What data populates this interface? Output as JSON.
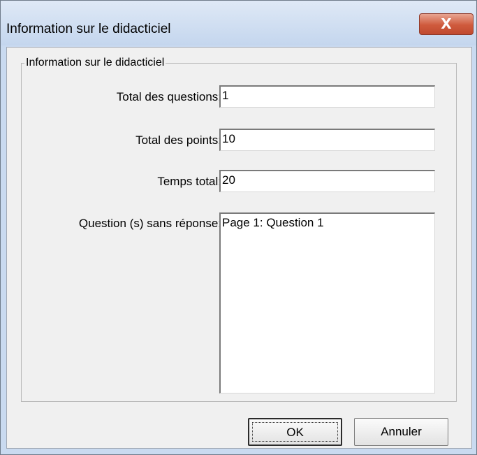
{
  "window": {
    "title": "Information sur le didacticiel",
    "close_glyph": "X",
    "close_icon": "close-icon"
  },
  "group": {
    "legend": "Information sur le didacticiel"
  },
  "fields": {
    "total_questions": {
      "label": "Total des questions:",
      "value": "1"
    },
    "total_points": {
      "label": "Total des points:",
      "value": "10"
    },
    "total_time": {
      "label": "Temps total:",
      "value": "20"
    },
    "unanswered": {
      "label": "Question (s) sans réponse:",
      "value": "Page 1: Question 1"
    }
  },
  "buttons": {
    "ok": "OK",
    "cancel": "Annuler"
  },
  "colors": {
    "titlebar": "#c9daf0",
    "close_button": "#cf5a3d",
    "dialog_background": "#f0f0f0"
  }
}
